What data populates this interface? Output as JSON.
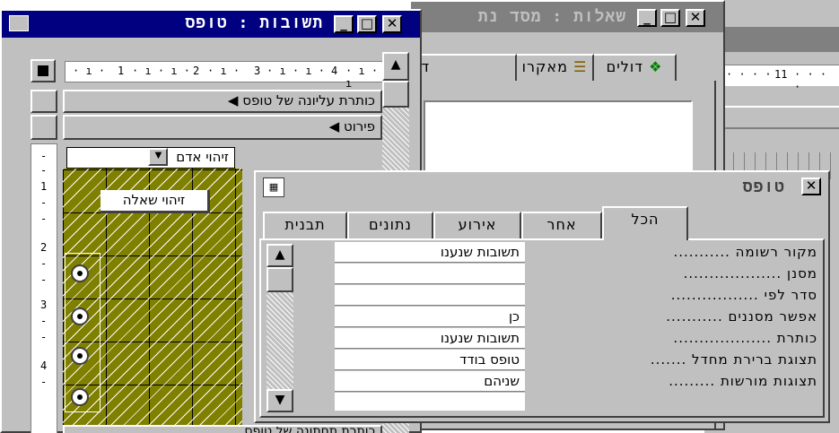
{
  "background_window": {
    "ruler_number": "11",
    "fields_hint": "‫‬"
  },
  "query_window": {
    "title": "שאלות : מסד נת",
    "tabs": [
      {
        "label": "דולים",
        "icon": "tables-icon"
      },
      {
        "label": "מאקרו",
        "icon": "macro-icon"
      },
      {
        "label": "דו",
        "icon": ""
      }
    ]
  },
  "form_window": {
    "title": "תשובות : טופס",
    "ruler_numbers": [
      "1",
      "2",
      "3",
      "4"
    ],
    "vertical_ruler_numbers": [
      "1",
      "2",
      "3",
      "4"
    ],
    "sections": {
      "form_header": "כותרת עליונה של טופס",
      "detail": "פירוט"
    },
    "combo_label": "זיהוי אדם",
    "field_label": "זיהוי שאלה",
    "footer_label": "כותרת תחתונה של טופס"
  },
  "properties_window": {
    "title": "טופס",
    "tabs": [
      "תבנית",
      "נתונים",
      "אירוע",
      "אחר",
      "הכל"
    ],
    "active_tab": "הכל",
    "rows": [
      {
        "label": "מקור רשומה",
        "dots": "...........",
        "value": "תשובות שנענו"
      },
      {
        "label": "מסנן",
        "dots": "...................",
        "value": ""
      },
      {
        "label": "סדר לפי",
        "dots": ".................",
        "value": ""
      },
      {
        "label": "אפשר מסננים",
        "dots": "...........",
        "value": "כן"
      },
      {
        "label": "כותרת",
        "dots": "...................",
        "value": "תשובות שנענו"
      },
      {
        "label": "תצוגת ברירת מחדל",
        "dots": ".......",
        "value": "טופס בודד"
      },
      {
        "label": "תצוגות מורשות",
        "dots": ".........",
        "value": "שניהם"
      }
    ]
  }
}
